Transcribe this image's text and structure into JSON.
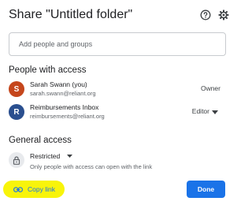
{
  "dialog": {
    "title": "Share \"Untitled folder\"",
    "icons": {
      "help": "help-circle-icon",
      "settings": "gear-icon"
    }
  },
  "add_people": {
    "placeholder": "Add people and groups",
    "value": ""
  },
  "people_section": {
    "heading": "People with access",
    "people": [
      {
        "name": "Sarah Swann (you)",
        "email": "sarah.swann@reliant.org",
        "role": "Owner",
        "initial": "S",
        "avatar_color": "#c5461c",
        "has_dropdown": false
      },
      {
        "name": "Reimbursements Inbox",
        "email": "reimbursements@reliant.org",
        "role": "Editor",
        "initial": "R",
        "avatar_color": "#2a4f8f",
        "has_dropdown": true
      }
    ]
  },
  "general_access": {
    "heading": "General access",
    "level": "Restricted",
    "description": "Only people with access can open with the link",
    "icon": "lock-icon"
  },
  "footer": {
    "copy_link_label": "Copy link",
    "copy_link_icon": "link-icon",
    "highlight_color": "#f8f40a",
    "done_label": "Done",
    "accent": "#1a73e8"
  }
}
